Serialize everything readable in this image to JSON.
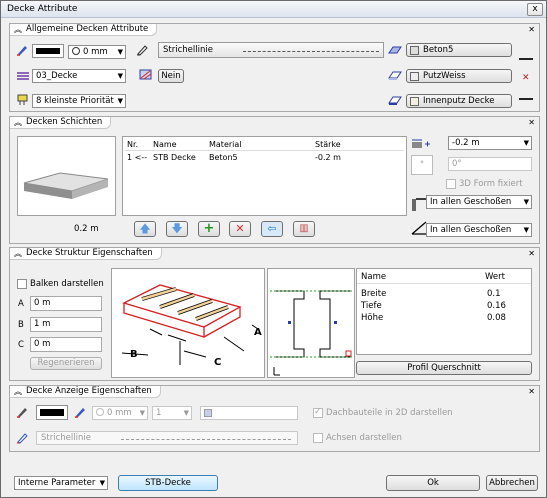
{
  "window": {
    "title": "Decke Attribute",
    "close_label": "x"
  },
  "sec1": {
    "title": "Allgemeine Decken Attribute",
    "pen_value": "0 mm",
    "layer": "03_Decke",
    "priority": "8 kleinste Priorität",
    "linetype": "Strichellinie",
    "nein": "Nein",
    "mat1": "Beton5",
    "mat2": "PutzWeiss",
    "mat3": "Innenputz Decke"
  },
  "sec2": {
    "title": "Decken Schichten",
    "thickness": "0.2 m",
    "cols": [
      "Nr.",
      "Name",
      "Material",
      "Stärke"
    ],
    "rows": [
      {
        "nr": "1 <--",
        "name": "STB Decke",
        "material": "Beton5",
        "staerke": "-0.2 m"
      }
    ],
    "offset": "-0.2 m",
    "angle": "0°",
    "form3d": "3D Form fixiert",
    "geschoss1": "In allen Geschoßen",
    "geschoss2": "In allen Geschoßen",
    "deg_label": "°"
  },
  "sec3": {
    "title": "Decke Struktur Eigenschaften",
    "balken": "Balken darstellen",
    "a_label": "A",
    "a_value": "0 m",
    "b_label": "B",
    "b_value": "1 m",
    "c_label": "C",
    "c_value": "0 m",
    "regen": "Regenerieren",
    "cols": [
      "Name",
      "Wert"
    ],
    "rows": [
      {
        "name": "Breite",
        "wert": "0.1"
      },
      {
        "name": "Tiefe",
        "wert": "0.16"
      },
      {
        "name": "Höhe",
        "wert": "0.08"
      }
    ],
    "profil": "Profil Querschnitt",
    "diag_a": "A",
    "diag_b": "B",
    "diag_c": "C"
  },
  "sec4": {
    "title": "Decke Anzeige Eigenschaften",
    "pen": "0 mm",
    "num": "1",
    "linetype": "Strichellinie",
    "dach": "Dachbauteile in 2D darstellen",
    "achsen": "Achsen darstellen"
  },
  "footer": {
    "params": "Interne Parameter",
    "stb": "STB-Decke",
    "ok": "Ok",
    "cancel": "Abbrechen"
  }
}
